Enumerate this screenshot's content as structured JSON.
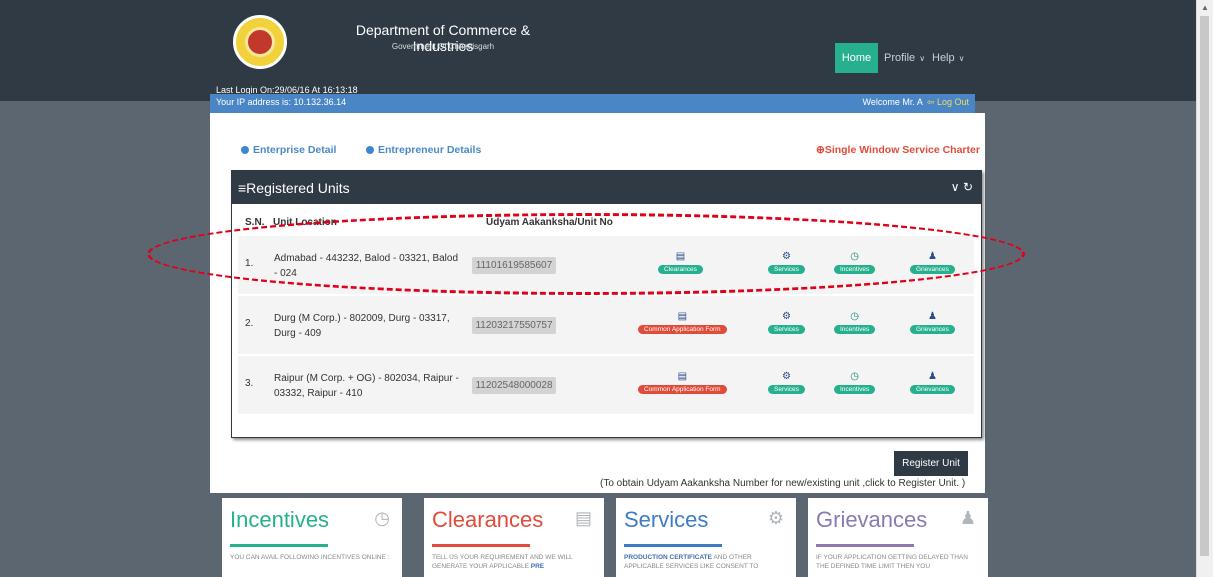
{
  "header": {
    "title": "Department of Commerce & Industries",
    "subtitle": "Government Of Chhattisgarh",
    "nav": [
      {
        "label": "Home"
      },
      {
        "label": "Profile"
      },
      {
        "label": "Help"
      }
    ]
  },
  "session": {
    "last_login": "Last Login On:29/06/16 At 16:13:18",
    "ip": "Your IP address is: 10.132.36.14",
    "welcome": "Welcome Mr. A",
    "logout": "Log Out"
  },
  "links": {
    "enterprise": "Enterprise Detail",
    "entrepreneur": "Entrepreneur Details",
    "charter": "Single Window Service Charter"
  },
  "panel": {
    "title": "Registered Units",
    "col_sn": "S.N.",
    "col_location": "Unit Location",
    "col_no": "Udyam Aakanksha/Unit No",
    "rows": [
      {
        "sn": "1.",
        "location": "Admabad - 443232, Balod - 03321, Balod - 024",
        "no": "11101619585607",
        "primary": "Clearances",
        "services": "Services",
        "incentives": "Incentives",
        "grievances": "Grievances"
      },
      {
        "sn": "2.",
        "location": "Durg (M Corp.) - 802009, Durg - 03317, Durg - 409",
        "no": "11203217550757",
        "primary": "Common Application Form",
        "services": "Services",
        "incentives": "Incentives",
        "grievances": "Grievances"
      },
      {
        "sn": "3.",
        "location": "Raipur (M Corp. + OG) - 802034, Raipur - 03332, Raipur - 410",
        "no": "11202548000028",
        "primary": "Common Application Form",
        "services": "Services",
        "incentives": "Incentives",
        "grievances": "Grievances"
      }
    ]
  },
  "register": {
    "button": "Register Unit",
    "note": "(To obtain Udyam Aakanksha Number for new/existing unit ,click to Register Unit. )"
  },
  "cards": [
    {
      "title": "Incentives",
      "color": "#26b08e",
      "text": "YOU CAN AVAIL FOLLOWING INCENTIVES ONLINE :",
      "strong": ""
    },
    {
      "title": "Clearances",
      "color": "#e04b3a",
      "text": "TELL US YOUR REQUIREMENT AND WE WILL GENERATE YOUR APPLICABLE ",
      "strong": "PRE"
    },
    {
      "title": "Services",
      "color": "#3e7cc4",
      "text": " AND OTHER APPLICABLE SERVICES LIKE CONSENT TO",
      "strong": "PRODUCTION CERTIFICATE"
    },
    {
      "title": "Grievances",
      "color": "#8a7ab0",
      "text": "IF YOUR APPLICATION GETTING DELAYED THAN THE DEFINED TIME LIMIT THEN YOU",
      "strong": ""
    }
  ],
  "colors": {
    "header": "#2f3a44",
    "accent_teal": "#26b08e",
    "accent_red": "#e04b3a",
    "ip_bar": "#4a86c5",
    "annotation": "#e0001a"
  }
}
